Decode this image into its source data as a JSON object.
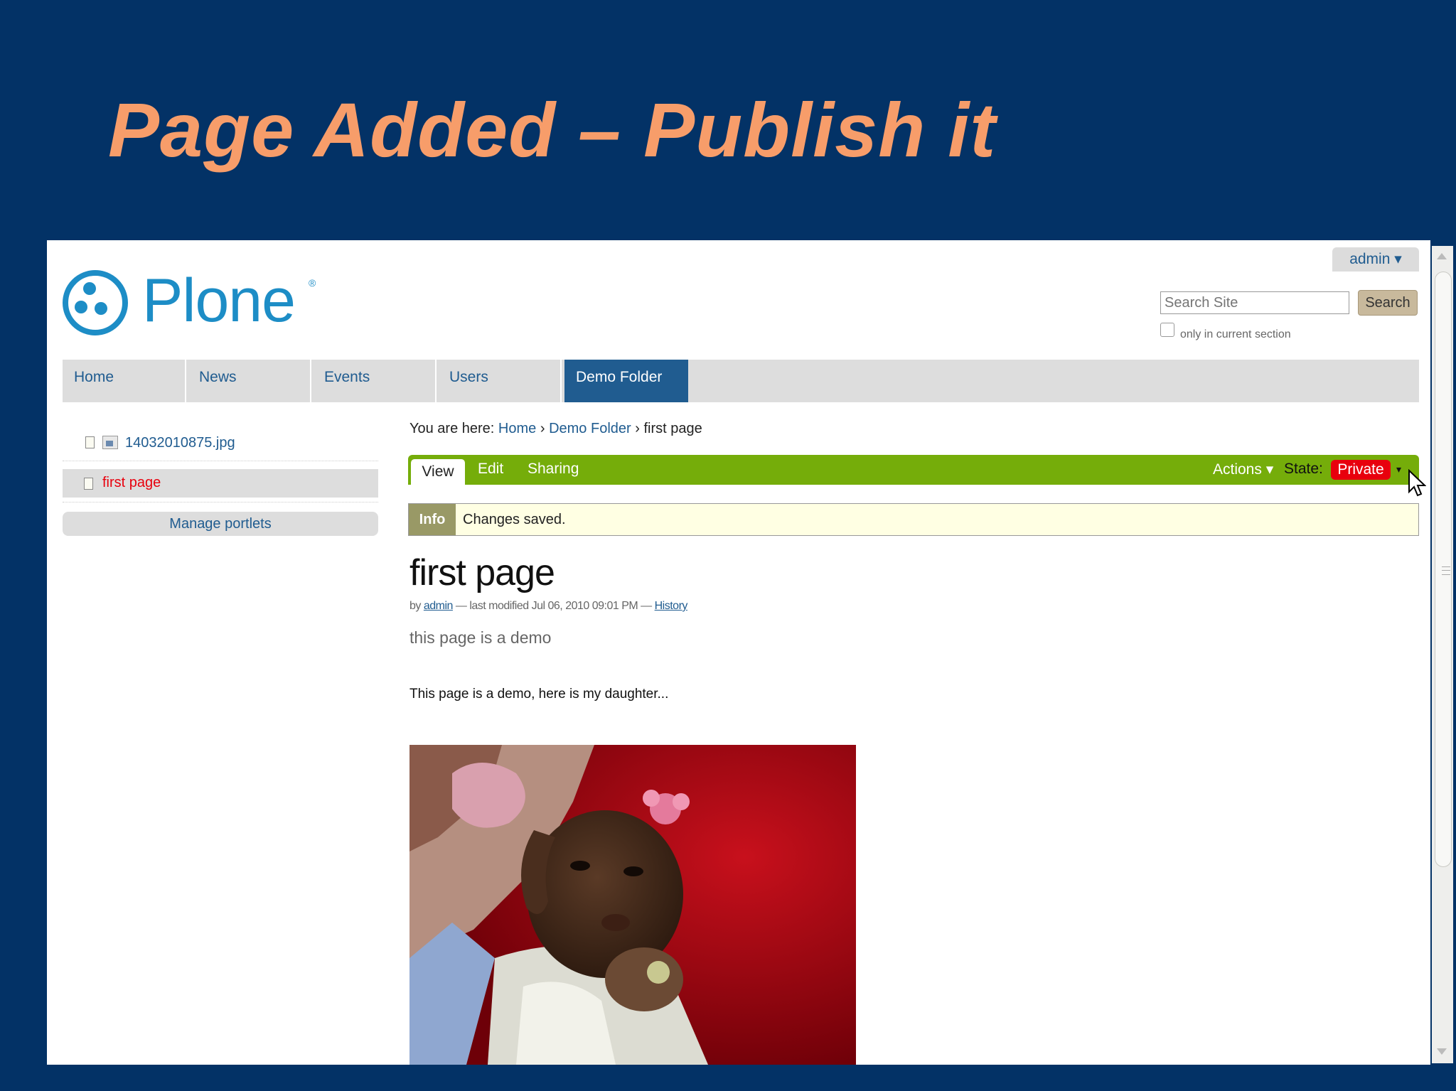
{
  "slide": {
    "title": "Page Added – Publish it"
  },
  "header": {
    "admin_label": "admin ▾",
    "logo_text": "Plone",
    "logo_reg": "®",
    "search_placeholder": "Search Site",
    "search_button": "Search",
    "only_section_label": "only in current section"
  },
  "nav": {
    "items": [
      {
        "label": "Home"
      },
      {
        "label": "News"
      },
      {
        "label": "Events"
      },
      {
        "label": "Users"
      },
      {
        "label": "Demo Folder"
      }
    ],
    "active_index": 4
  },
  "sidebar": {
    "items": [
      {
        "label": "14032010875.jpg"
      },
      {
        "label": "first page"
      }
    ],
    "manage_portlets": "Manage portlets"
  },
  "breadcrumb": {
    "prefix": "You are here:",
    "home": "Home",
    "sep": "›",
    "folder": "Demo Folder",
    "current": "first page"
  },
  "edit_bar": {
    "tabs": [
      {
        "label": "View"
      },
      {
        "label": "Edit"
      },
      {
        "label": "Sharing"
      }
    ],
    "actions_label": "Actions ▾",
    "state_label": "State:",
    "state_value": "Private",
    "state_caret": "▾",
    "bar_color": "#75ad0a",
    "state_color": "#e8000d"
  },
  "info": {
    "label": "Info",
    "message": "Changes saved."
  },
  "document": {
    "title": "first page",
    "by": "by",
    "author": "admin",
    "modified": "— last modified Jul 06, 2010 09:01 PM —",
    "history": "History",
    "description": "this page is a demo",
    "body": "This page is a demo, here is my daughter..."
  }
}
